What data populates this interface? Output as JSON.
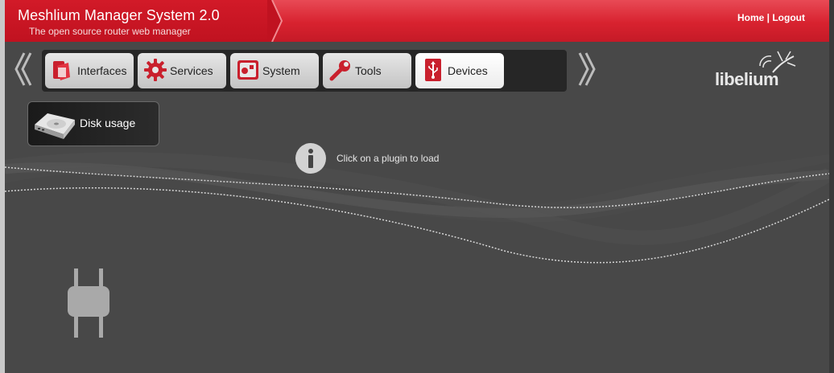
{
  "app": {
    "title": "Meshlium Manager System 2.0",
    "subtitle": "The open source router web manager"
  },
  "top_links": {
    "home": "Home",
    "separator": "|",
    "logout": "Logout"
  },
  "nav": {
    "tabs": [
      {
        "label": "Interfaces",
        "icon": "interfaces-icon",
        "active": false
      },
      {
        "label": "Services",
        "icon": "gear-icon",
        "active": false
      },
      {
        "label": "System",
        "icon": "system-icon",
        "active": false
      },
      {
        "label": "Tools",
        "icon": "wrench-icon",
        "active": false
      },
      {
        "label": "Devices",
        "icon": "usb-icon",
        "active": true
      }
    ]
  },
  "logo": {
    "text": "libelium",
    "icon": "mosquito-icon"
  },
  "plugins": [
    {
      "label": "Disk usage",
      "icon": "hard-drive-icon"
    }
  ],
  "main": {
    "info_message": "Click on a plugin to load"
  },
  "colors": {
    "header_red": "#d8222f",
    "brand_dark_red": "#c01220",
    "background": "#484848",
    "tab_bar": "#262626",
    "accent_red": "#d8222f"
  }
}
